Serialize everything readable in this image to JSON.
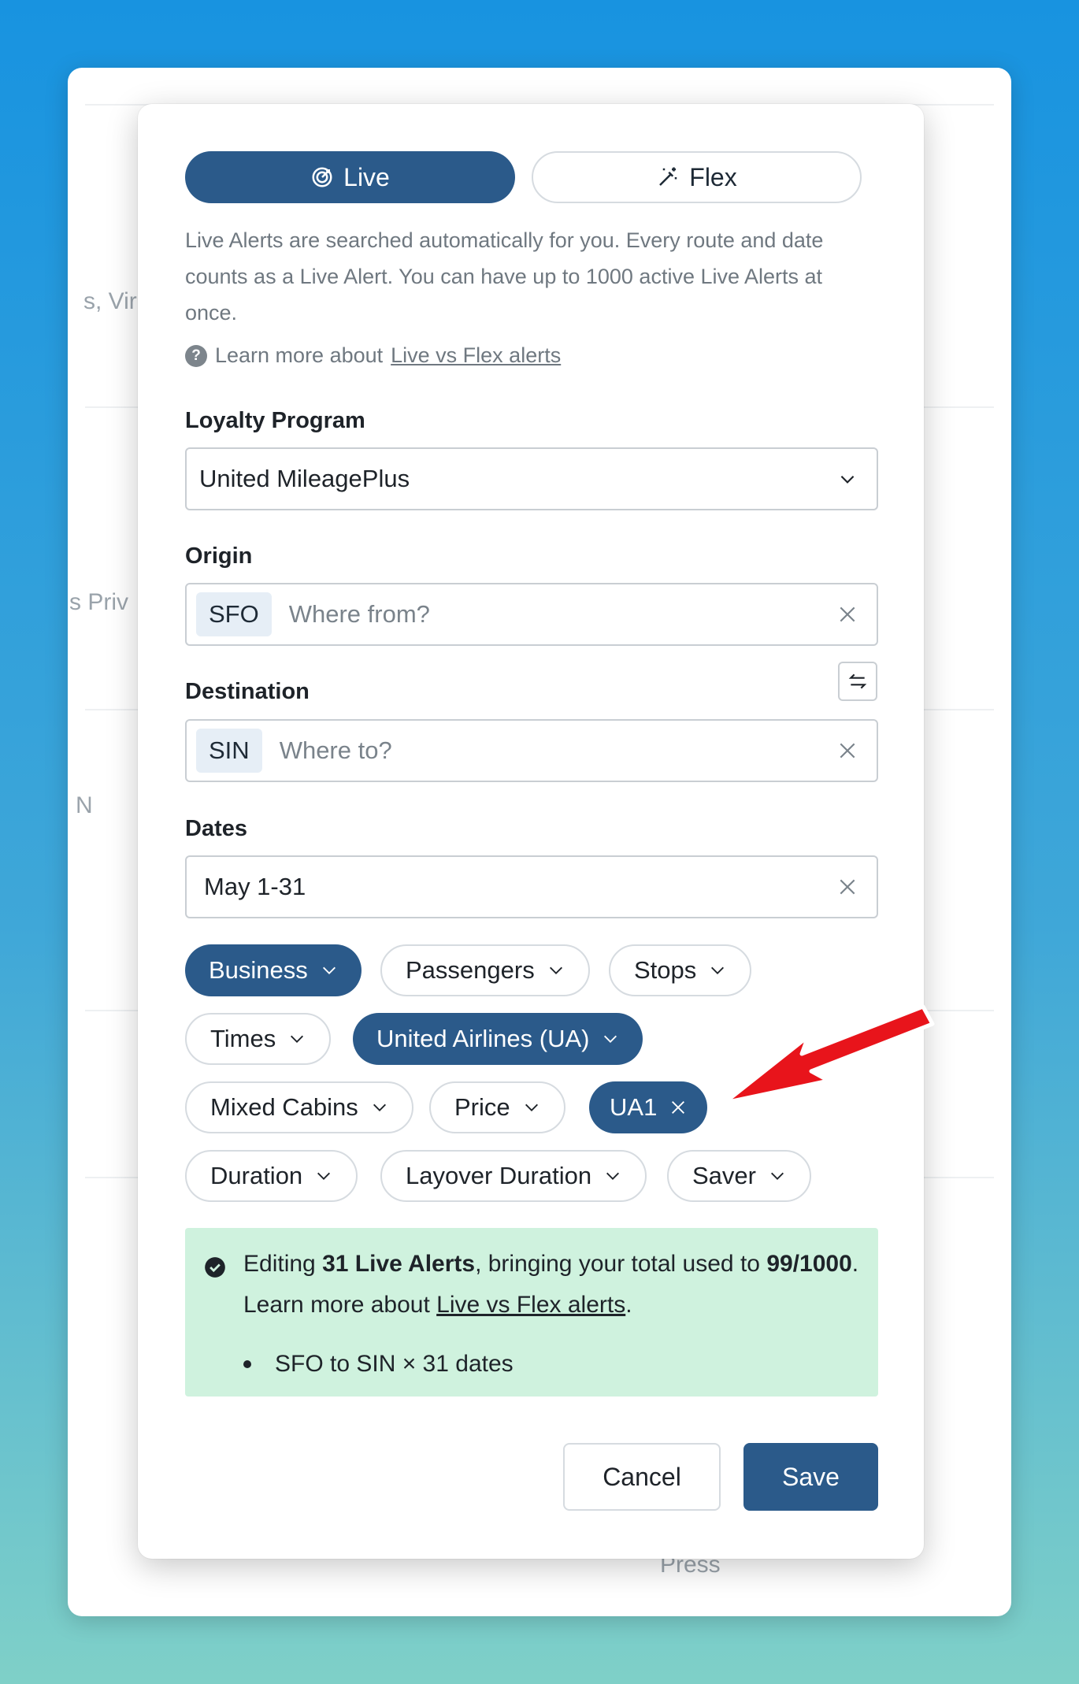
{
  "background": {
    "fragments": [
      "s, Vir",
      "s Priv",
      "N",
      "Press"
    ]
  },
  "modal": {
    "tabs": [
      {
        "label": "Live",
        "icon": "target-icon",
        "active": true
      },
      {
        "label": "Flex",
        "icon": "magic-wand-icon",
        "active": false
      }
    ],
    "description": "Live Alerts are searched automatically for you. Every route and date counts as a Live Alert. You can have up to 1000 active Live Alerts at once.",
    "learn_prefix": "Learn more about ",
    "learn_link": "Live vs Flex alerts",
    "loyalty": {
      "label": "Loyalty Program",
      "value": "United MileagePlus"
    },
    "origin": {
      "label": "Origin",
      "chip": "SFO",
      "placeholder": "Where from?"
    },
    "destination": {
      "label": "Destination",
      "chip": "SIN",
      "placeholder": "Where to?"
    },
    "dates": {
      "label": "Dates",
      "value": "May 1-31"
    },
    "filters": [
      {
        "label": "Business",
        "active": true
      },
      {
        "label": "Passengers",
        "active": false
      },
      {
        "label": "Stops",
        "active": false
      },
      {
        "label": "Times",
        "active": false
      },
      {
        "label": "United Airlines (UA)",
        "active": true
      },
      {
        "label": "Mixed Cabins",
        "active": false
      },
      {
        "label": "Price",
        "active": false
      },
      {
        "label": "UA1",
        "active": true,
        "removable": true
      },
      {
        "label": "Duration",
        "active": false
      },
      {
        "label": "Layover Duration",
        "active": false
      },
      {
        "label": "Saver",
        "active": false
      }
    ],
    "notice": {
      "prefix": "Editing ",
      "count_bold": "31 Live Alerts",
      "middle": ", bringing your total used to ",
      "total_bold": "99/1000",
      "suffix": ". Learn more about ",
      "link": "Live vs Flex alerts",
      "end": ".",
      "bullet": "SFO to SIN × 31 dates"
    },
    "cancel_label": "Cancel",
    "save_label": "Save"
  },
  "colors": {
    "accent": "#2b5a8a",
    "notice_bg": "#cff2de",
    "arrow": "#e8141b"
  }
}
